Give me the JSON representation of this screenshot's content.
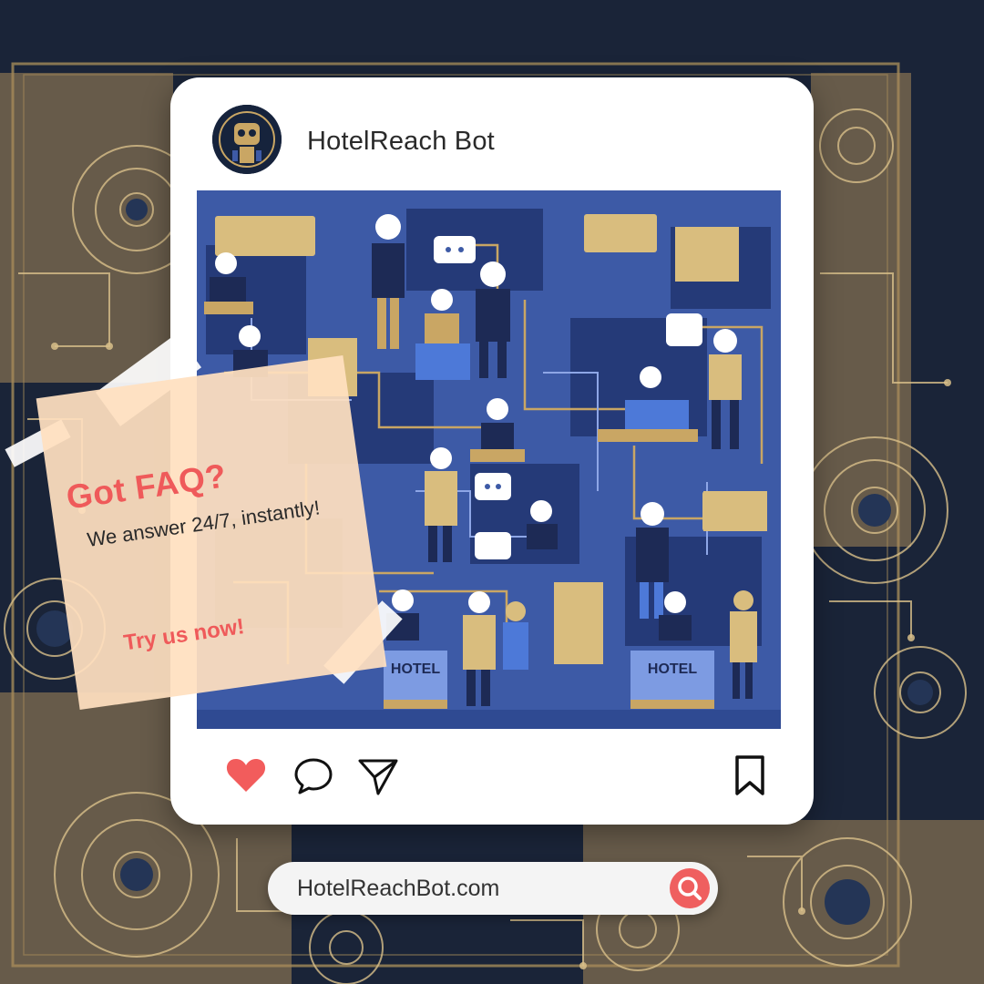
{
  "post": {
    "account_name": "HotelReach Bot",
    "image": {
      "description_icon": "hotel-robots-illustration",
      "sign_labels": [
        "HOTEL",
        "HOTEL"
      ]
    },
    "actions": {
      "like_icon": "heart-icon",
      "comment_icon": "comment-icon",
      "share_icon": "send-icon",
      "save_icon": "bookmark-icon"
    }
  },
  "note": {
    "headline": "Got FAQ?",
    "body": "We answer 24/7, instantly!",
    "cta": "Try us now!"
  },
  "search": {
    "url": "HotelReachBot.com",
    "button_icon": "search-icon"
  },
  "colors": {
    "background": "#1a2438",
    "card": "#ffffff",
    "accent": "#ef5a5a",
    "note": "#ffe0c0",
    "illustration_blue": "#3d5aa6",
    "illustration_gold": "#c9a664"
  }
}
